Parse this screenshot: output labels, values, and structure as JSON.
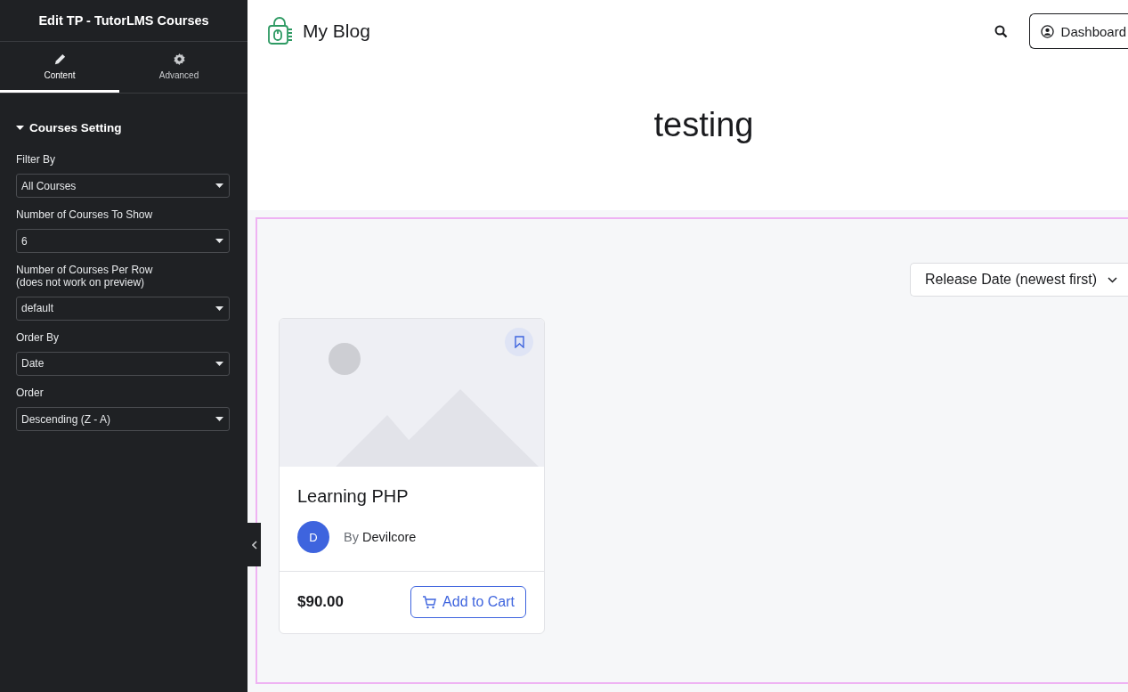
{
  "sidebar": {
    "title": "Edit TP - TutorLMS Courses",
    "tabs": [
      {
        "label": "Content",
        "kind": "pencil",
        "selected": true
      },
      {
        "label": "Advanced",
        "kind": "gear",
        "selected": false
      }
    ],
    "section": {
      "title": "Courses Setting",
      "expanded": true
    },
    "fields": [
      {
        "label": "Filter By",
        "value": "All Courses"
      },
      {
        "label": "Number of Courses To Show",
        "value": "6"
      },
      {
        "label": "Number of Courses Per Row\n(does not work on preview)",
        "value": "default"
      },
      {
        "label": "Order By",
        "value": "Date"
      },
      {
        "label": "Order",
        "value": "Descending (Z - A)"
      }
    ]
  },
  "header": {
    "site_title": "My Blog",
    "button": "Dashboard"
  },
  "page_title": "testing",
  "sort": {
    "value": "Release Date (newest first)"
  },
  "courses": [
    {
      "kind": "picture",
      "title": "Learning PHP",
      "author_initial": "D",
      "by": "By",
      "author": "Devilcore",
      "price": "$90.00",
      "button": "Add to Cart"
    }
  ]
}
